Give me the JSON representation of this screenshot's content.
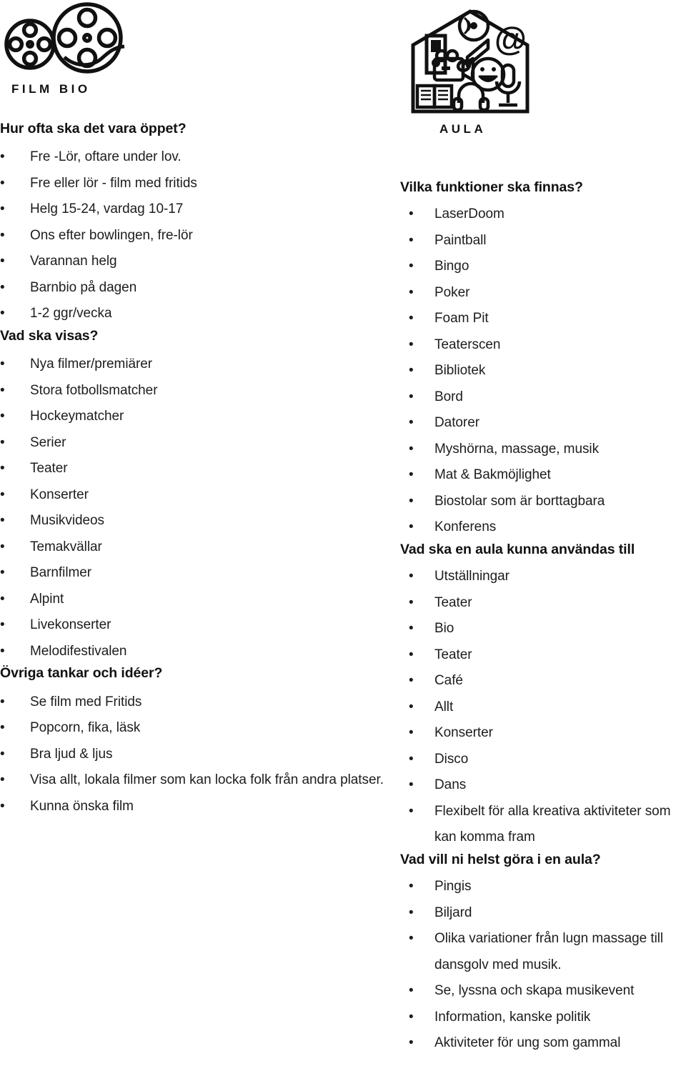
{
  "left": {
    "logo": {
      "caption": "FILM BIO",
      "icon": "film-reel-icon"
    },
    "sections": [
      {
        "heading": "Hur ofta ska det vara öppet?",
        "items": [
          "Fre -Lör, oftare under lov.",
          "Fre eller lör - film med fritids",
          "Helg 15-24, vardag 10-17",
          "Ons efter bowlingen, fre-lör",
          "Varannan helg",
          "Barnbio på dagen",
          "1-2 ggr/vecka"
        ]
      },
      {
        "heading": "Vad ska visas?",
        "items": [
          "Nya filmer/premiärer",
          "Stora fotbollsmatcher",
          "Hockeymatcher",
          "Serier",
          "Teater",
          "Konserter",
          "Musikvideos",
          "Temakvällar",
          "Barnfilmer",
          "Alpint",
          "Livekonserter",
          "Melodifestivalen"
        ]
      },
      {
        "heading": "Övriga tankar och idéer?",
        "items": [
          "Se film med Fritids",
          "Popcorn, fika, läsk",
          "Bra ljud & ljus",
          "Visa allt, lokala filmer som kan locka folk från andra platser.",
          "Kunna önska film"
        ]
      }
    ]
  },
  "right": {
    "logo": {
      "caption": "AULA",
      "icon": "house-media-icon"
    },
    "sections": [
      {
        "heading": "Vilka funktioner ska finnas?",
        "items": [
          "LaserDoom",
          "Paintball",
          "Bingo",
          "Poker",
          "Foam Pit",
          "Teaterscen",
          "Bibliotek",
          "Bord",
          "Datorer",
          "Myshörna, massage, musik",
          "Mat & Bakmöjlighet",
          "Biostolar som är borttagbara",
          "Konferens"
        ]
      },
      {
        "heading": "Vad ska en aula kunna användas till",
        "items": [
          "Utställningar",
          "Teater",
          "Bio",
          "Teater",
          "Café",
          "Allt",
          "Konserter",
          "Disco",
          "Dans",
          "Flexibelt för alla kreativa aktiviteter som kan komma fram"
        ]
      },
      {
        "heading": "Vad vill ni helst göra i en aula?",
        "items": [
          "Pingis",
          "Biljard",
          "Olika variationer från lugn massage till dansgolv med musik.",
          "Se, lyssna och skapa musikevent",
          "Information, kanske politik",
          "Aktiviteter för ung som gammal"
        ]
      }
    ]
  },
  "colors": {
    "ink": "#1a1a1a",
    "background": "#ffffff"
  }
}
